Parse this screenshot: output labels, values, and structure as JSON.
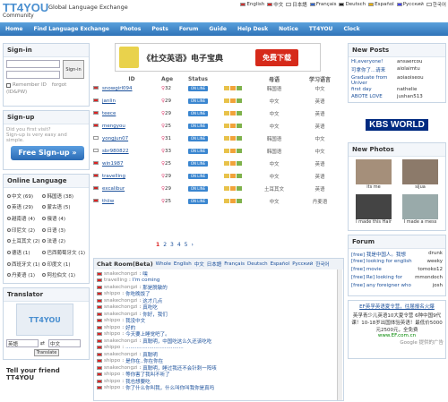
{
  "header": {
    "logo": "TT4YOU",
    "tagline": "Global Language Exchange",
    "community": "Community",
    "languages": [
      "English",
      "中文",
      "日本語",
      "Français",
      "Deutsch",
      "Español",
      "Русский",
      "한국어"
    ]
  },
  "nav": [
    "Home",
    "Find Language Exchange",
    "Photos",
    "Posts",
    "Forum",
    "Guide",
    "Help Desk",
    "Notice",
    "TT4YOU",
    "Clock"
  ],
  "signin": {
    "title": "Sign-in",
    "button": "Sign-in",
    "remember": "Remember ID",
    "forgot": "forgot",
    "id_pw": "(ID&PW)"
  },
  "signup": {
    "title": "Sign-up",
    "text": "Sign-up is very easy and simple.",
    "text2": "Did you first visit?",
    "button": "Free Sign-up »"
  },
  "online_language": {
    "title": "Online Language",
    "items": [
      {
        "label": "中文 (69)"
      },
      {
        "label": "韩国语 (38)"
      },
      {
        "label": "英语 (29)"
      },
      {
        "label": "蒙古语 (5)"
      },
      {
        "label": "越南语 (4)"
      },
      {
        "label": "俄语 (4)"
      },
      {
        "label": "印尼文 (2)"
      },
      {
        "label": "日语 (3)"
      },
      {
        "label": "土耳其文 (2)"
      },
      {
        "label": "法语 (2)"
      },
      {
        "label": "德语 (1)"
      },
      {
        "label": "巴西葡萄牙文 (1)"
      },
      {
        "label": "西班牙文 (1)"
      },
      {
        "label": "印度文 (1)"
      },
      {
        "label": "丹麦语 (1)"
      },
      {
        "label": "阿拉伯文 (1)"
      }
    ]
  },
  "translator": {
    "title": "Translator",
    "from": "英語",
    "to": "中文",
    "button": "Translate"
  },
  "tell_friend": "Tell your friend TT4YOU",
  "banner": {
    "text": "《杜交英语》电子宝典",
    "button": "免费下载"
  },
  "table": {
    "headers": [
      "ID",
      "Age",
      "Status",
      "",
      "母语",
      "学习语言"
    ],
    "rows": [
      {
        "id": "snowgirl094",
        "age": "32",
        "native": "韩国语",
        "study": "中文"
      },
      {
        "id": "janlin",
        "age": "29",
        "native": "中文",
        "study": "英语"
      },
      {
        "id": "teece",
        "age": "29",
        "native": "中文",
        "study": "英语"
      },
      {
        "id": "mengyou",
        "age": "25",
        "native": "中文",
        "study": "英语"
      },
      {
        "id": "yongjun07",
        "age": "31",
        "native": "韩国语",
        "study": "中文"
      },
      {
        "id": "sbr980822",
        "age": "33",
        "native": "韩国语",
        "study": "中文"
      },
      {
        "id": "win1987",
        "age": "25",
        "native": "中文",
        "study": "英语"
      },
      {
        "id": "travelling",
        "age": "29",
        "native": "中文",
        "study": "英语"
      },
      {
        "id": "excalibur",
        "age": "29",
        "native": "土耳其文",
        "study": "英语"
      },
      {
        "id": "thiiw",
        "age": "25",
        "native": "中文",
        "study": "丹麦语"
      }
    ],
    "status": "ON LINE"
  },
  "pager": [
    "1",
    "2",
    "3",
    "4",
    "5"
  ],
  "chat": {
    "title": "Chat Room(Beta)",
    "tabs": [
      "Whole",
      "English",
      "中文",
      "日本語",
      "Français",
      "Deutsch",
      "Español",
      "Русский",
      "한국어"
    ],
    "lines": [
      {
        "user": "snakechongzi",
        "msg": "嘿"
      },
      {
        "user": "travelling",
        "msg": "I'm coming"
      },
      {
        "user": "snakechongzi",
        "msg": "那是脱敏的"
      },
      {
        "user": "shippo",
        "msg": "你吃晚饭了"
      },
      {
        "user": "snakechongzi",
        "msg": "这才几点"
      },
      {
        "user": "snakechongzi",
        "msg": "真吃吃"
      },
      {
        "user": "snakechongzi",
        "msg": "你好，我们"
      },
      {
        "user": "shippo",
        "msg": "我没中文"
      },
      {
        "user": "shippo",
        "msg": "好的"
      },
      {
        "user": "shippo",
        "msg": "今天要上睡觉吧了。"
      },
      {
        "user": "snakechongzi",
        "msg": "真聪明，中国吃这么久还该吃吃"
      },
      {
        "user": "shippo",
        "msg": "....................................."
      },
      {
        "user": "snakechongzi",
        "msg": "真聪明"
      },
      {
        "user": "shippo",
        "msg": "是你在..你在你在"
      },
      {
        "user": "snakechongzi",
        "msg": "真聪明，睡过我还不会针刺一阵咳"
      },
      {
        "user": "shippo",
        "msg": "等你害了我叫不听了"
      },
      {
        "user": "shippo",
        "msg": "我也想要吃"
      },
      {
        "user": "shippo",
        "msg": "你了什么你叫我，什么叫你叫我你是真吗"
      }
    ]
  },
  "new_posts": {
    "title": "New Posts",
    "items": [
      "Hi,everyone!",
      "ansaercou",
      "可拿你了...请来",
      "aiolaimtu",
      "Graduate from Univer",
      "aoiaoiseou",
      "first day",
      "nathelie",
      "ABOTE LOVE",
      "jushan513"
    ]
  },
  "kbs": "KBS WORLD",
  "new_photos": {
    "title": "New Photos",
    "items": [
      {
        "caption": "its me"
      },
      {
        "caption": "sijua"
      },
      {
        "caption": "I made this Hair"
      },
      {
        "caption": "I made a mess"
      }
    ]
  },
  "forum": {
    "title": "Forum",
    "items": [
      {
        "text": "[free] 我是中国人。我想",
        "user": "drunk"
      },
      {
        "text": "[free] looking for english",
        "user": "weeky"
      },
      {
        "text": "[free] movie",
        "user": "tomoko12"
      },
      {
        "text": "[free] Re] looking for",
        "user": "mmondoch"
      },
      {
        "text": "[free] any foreigner who",
        "user": "josh"
      }
    ]
  },
  "ad": {
    "title": "EF英孚英语夏令营，往届报名火爆",
    "text": "英孚青少儿英语10大夏令营 6种中国9代课！10-18岁出国体验英语！最低价5000元2500元，全免费",
    "url": "www.EF.com.cn",
    "footer": "Google 提供的广告"
  }
}
